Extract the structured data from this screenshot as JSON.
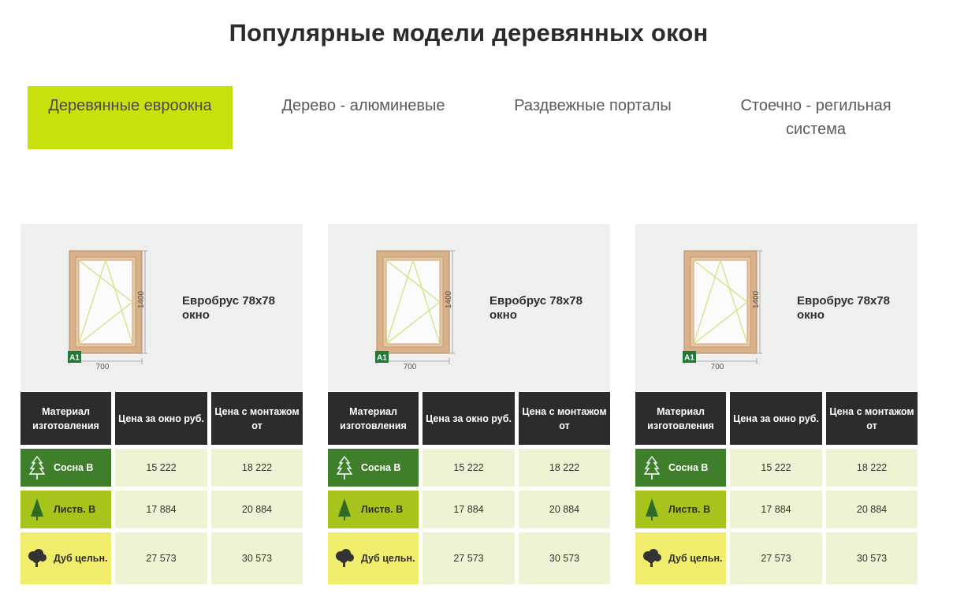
{
  "title": "Популярные модели деревянных окон",
  "tabs": [
    {
      "label": "Деревянные евроокна",
      "active": true
    },
    {
      "label": "Дерево - алюминевые",
      "active": false
    },
    {
      "label": "Раздвежные порталы",
      "active": false
    },
    {
      "label": "Стоечно - регильная система",
      "active": false
    }
  ],
  "colors": {
    "accent": "#c8e00e",
    "header": "#2c2c2c",
    "pine": "#3f7f2c",
    "larch": "#a6c41c",
    "oak": "#f0ec6c",
    "value_bg": "#eef4d3"
  },
  "cards": [
    {
      "title_line1": "Евробрус 78x78",
      "title_line2": "окно",
      "height_label": "1400",
      "width_label": "700",
      "badge": "A1",
      "headers": [
        "Материал изготовления",
        "Цена за окно руб.",
        "Цена с монтажом от"
      ],
      "rows": [
        {
          "material": "Сосна В",
          "icon": "pine-tree-icon",
          "price": "15 222",
          "price_install": "18 222"
        },
        {
          "material": "Листв. В",
          "icon": "larch-tree-icon",
          "price": "17 884",
          "price_install": "20 884"
        },
        {
          "material": "Дуб цельн.",
          "icon": "oak-tree-icon",
          "price": "27 573",
          "price_install": "30 573"
        }
      ]
    },
    {
      "title_line1": "Евробрус 78x78",
      "title_line2": "окно",
      "height_label": "1400",
      "width_label": "700",
      "badge": "A1",
      "headers": [
        "Материал изготовления",
        "Цена за окно руб.",
        "Цена с монтажом от"
      ],
      "rows": [
        {
          "material": "Сосна В",
          "icon": "pine-tree-icon",
          "price": "15 222",
          "price_install": "18 222"
        },
        {
          "material": "Листв. В",
          "icon": "larch-tree-icon",
          "price": "17 884",
          "price_install": "20 884"
        },
        {
          "material": "Дуб цельн.",
          "icon": "oak-tree-icon",
          "price": "27 573",
          "price_install": "30 573"
        }
      ]
    },
    {
      "title_line1": "Евробрус 78x78",
      "title_line2": "окно",
      "height_label": "1400",
      "width_label": "700",
      "badge": "A1",
      "headers": [
        "Материал изготовления",
        "Цена за окно руб.",
        "Цена с монтажом от"
      ],
      "rows": [
        {
          "material": "Сосна В",
          "icon": "pine-tree-icon",
          "price": "15 222",
          "price_install": "18 222"
        },
        {
          "material": "Листв. В",
          "icon": "larch-tree-icon",
          "price": "17 884",
          "price_install": "20 884"
        },
        {
          "material": "Дуб цельн.",
          "icon": "oak-tree-icon",
          "price": "27 573",
          "price_install": "30 573"
        }
      ]
    }
  ]
}
